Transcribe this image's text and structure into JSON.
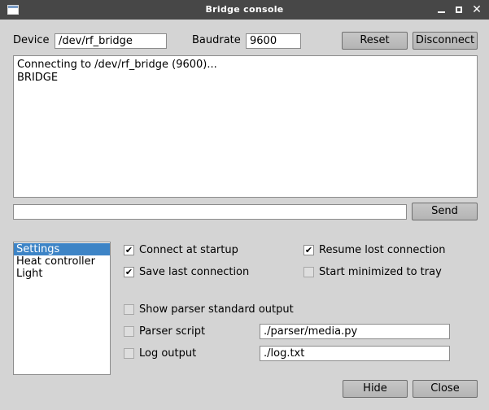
{
  "window": {
    "title": "Bridge console",
    "controls": {
      "minimize": "–",
      "maximize": "□",
      "close": "✕"
    }
  },
  "connection": {
    "device_label": "Device",
    "device_value": "/dev/rf_bridge",
    "baudrate_label": "Baudrate",
    "baudrate_value": "9600",
    "reset_label": "Reset",
    "disconnect_label": "Disconnect"
  },
  "console": {
    "lines": [
      "Connecting to /dev/rf_bridge (9600)...",
      "BRIDGE"
    ]
  },
  "command": {
    "input_value": "",
    "send_label": "Send"
  },
  "sidebar": {
    "items": [
      {
        "label": "Settings",
        "selected": true
      },
      {
        "label": "Heat controller",
        "selected": false
      },
      {
        "label": "Light",
        "selected": false
      }
    ]
  },
  "settings": {
    "connect_at_startup": {
      "label": "Connect at startup",
      "checked": true
    },
    "resume_lost_connection": {
      "label": "Resume lost connection",
      "checked": true
    },
    "save_last_connection": {
      "label": "Save last connection",
      "checked": true
    },
    "start_minimized": {
      "label": "Start minimized to tray",
      "checked": false
    },
    "show_parser_output": {
      "label": "Show parser standard output",
      "checked": false
    },
    "parser_script": {
      "label": "Parser script",
      "checked": false,
      "value": "./parser/media.py"
    },
    "log_output": {
      "label": "Log output",
      "checked": false,
      "value": "./log.txt"
    }
  },
  "footer": {
    "hide_label": "Hide",
    "close_label": "Close"
  },
  "colors": {
    "titlebar": "#474747",
    "window_bg": "#d4d4d4",
    "selection": "#3d84c6"
  }
}
